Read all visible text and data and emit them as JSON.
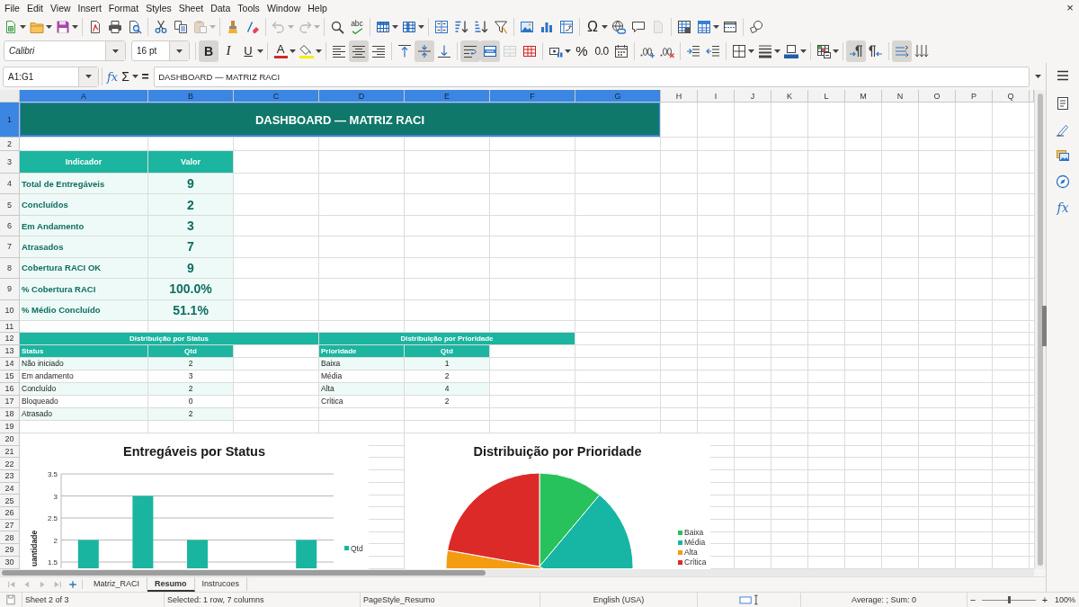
{
  "menu_bar": {
    "items": [
      "File",
      "Edit",
      "View",
      "Insert",
      "Format",
      "Styles",
      "Sheet",
      "Data",
      "Tools",
      "Window",
      "Help"
    ],
    "close": "×"
  },
  "standard_toolbar": {
    "groups": [
      [
        {
          "kind": "new",
          "disabled": false
        },
        {
          "kind": "caret",
          "disabled": false
        },
        {
          "kind": "open",
          "disabled": false
        },
        {
          "kind": "caret",
          "disabled": false
        },
        {
          "kind": "save",
          "disabled": false
        },
        {
          "kind": "caret",
          "disabled": false
        }
      ],
      [
        {
          "kind": "export-pdf",
          "disabled": false
        },
        {
          "kind": "print",
          "disabled": false
        },
        {
          "kind": "print-preview",
          "disabled": false
        }
      ],
      [
        {
          "kind": "cut",
          "disabled": false
        },
        {
          "kind": "copy",
          "disabled": false
        },
        {
          "kind": "paste",
          "disabled": true
        },
        {
          "kind": "caret",
          "disabled": true
        }
      ],
      [
        {
          "kind": "clone-formatting",
          "disabled": false
        },
        {
          "kind": "clear-formatting",
          "disabled": false
        }
      ],
      [
        {
          "kind": "undo",
          "disabled": true
        },
        {
          "kind": "caret",
          "disabled": true
        },
        {
          "kind": "redo",
          "disabled": true
        },
        {
          "kind": "caret",
          "disabled": true
        }
      ],
      [
        {
          "kind": "find-replace",
          "disabled": false
        },
        {
          "kind": "spelling",
          "label": "abc",
          "disabled": false
        }
      ],
      [
        {
          "kind": "row",
          "disabled": false
        },
        {
          "kind": "caret",
          "disabled": false
        },
        {
          "kind": "column",
          "disabled": false
        },
        {
          "kind": "caret",
          "disabled": false
        }
      ],
      [
        {
          "kind": "sort",
          "disabled": false
        },
        {
          "kind": "sort-ascending",
          "disabled": false
        },
        {
          "kind": "sort-descending",
          "disabled": false
        },
        {
          "kind": "autofilter",
          "disabled": false
        }
      ],
      [
        {
          "kind": "image",
          "disabled": false
        },
        {
          "kind": "chart",
          "disabled": false
        },
        {
          "kind": "pivot-table",
          "disabled": false
        }
      ],
      [
        {
          "kind": "special-character",
          "label": "Ω",
          "disabled": false
        },
        {
          "kind": "caret",
          "disabled": false
        },
        {
          "kind": "hyperlink",
          "disabled": false
        },
        {
          "kind": "comment",
          "disabled": false
        },
        {
          "kind": "header-footer",
          "disabled": true
        }
      ],
      [
        {
          "kind": "print-area",
          "disabled": false
        },
        {
          "kind": "freeze",
          "disabled": false
        },
        {
          "kind": "caret",
          "disabled": false
        },
        {
          "kind": "split-window",
          "disabled": false
        }
      ],
      [
        {
          "kind": "draw-functions",
          "disabled": false
        }
      ]
    ]
  },
  "formatting_toolbar": {
    "font_name": {
      "value": "Calibri"
    },
    "font_size": {
      "value": "16 pt"
    },
    "groups": [
      [
        {
          "kind": "bold",
          "label": "B",
          "active": true,
          "disabled": false
        },
        {
          "kind": "italic",
          "label": "I",
          "active": false,
          "disabled": false
        },
        {
          "kind": "underline",
          "label": "U",
          "active": false,
          "disabled": false
        },
        {
          "kind": "caret",
          "active": false,
          "disabled": false
        }
      ],
      [
        {
          "kind": "font-color",
          "label": "A",
          "active": false,
          "disabled": false
        },
        {
          "kind": "caret",
          "active": false,
          "disabled": false
        },
        {
          "kind": "highlight",
          "active": false,
          "disabled": false
        },
        {
          "kind": "caret",
          "active": false,
          "disabled": false
        }
      ],
      [
        {
          "kind": "align-left",
          "active": false,
          "disabled": false
        },
        {
          "kind": "align-center",
          "active": true,
          "disabled": false
        },
        {
          "kind": "align-right",
          "active": false,
          "disabled": false
        }
      ],
      [
        {
          "kind": "align-top",
          "active": false,
          "disabled": false
        },
        {
          "kind": "align-middle",
          "active": true,
          "disabled": false
        },
        {
          "kind": "align-bottom",
          "active": false,
          "disabled": false
        }
      ],
      [
        {
          "kind": "wrap",
          "active": true,
          "disabled": false
        },
        {
          "kind": "merge-center",
          "active": true,
          "disabled": false
        },
        {
          "kind": "merge",
          "active": false,
          "disabled": true
        },
        {
          "kind": "unmerge",
          "active": false,
          "disabled": false
        }
      ],
      [
        {
          "kind": "currency",
          "active": false,
          "disabled": false
        },
        {
          "kind": "caret",
          "active": false,
          "disabled": false
        },
        {
          "kind": "percent",
          "label": "%",
          "active": false,
          "disabled": false
        },
        {
          "kind": "number",
          "label": "0.0",
          "active": false,
          "disabled": false
        },
        {
          "kind": "date",
          "active": false,
          "disabled": false
        }
      ],
      [
        {
          "kind": "add-decimal",
          "active": false,
          "disabled": false
        },
        {
          "kind": "delete-decimal",
          "active": false,
          "disabled": false
        }
      ],
      [
        {
          "kind": "indent-increase",
          "active": false,
          "disabled": false
        },
        {
          "kind": "indent-decrease",
          "active": false,
          "disabled": false
        }
      ],
      [
        {
          "kind": "borders",
          "active": false,
          "disabled": false
        },
        {
          "kind": "caret",
          "active": false,
          "disabled": false
        },
        {
          "kind": "border-style",
          "active": false,
          "disabled": false
        },
        {
          "kind": "caret",
          "active": false,
          "disabled": false
        },
        {
          "kind": "border-color",
          "active": false,
          "disabled": false
        },
        {
          "kind": "caret",
          "active": false,
          "disabled": false
        }
      ],
      [
        {
          "kind": "conditional",
          "active": false,
          "disabled": false
        },
        {
          "kind": "caret",
          "active": false,
          "disabled": false
        }
      ],
      [
        {
          "kind": "ltr",
          "active": true,
          "disabled": false
        },
        {
          "kind": "rtl",
          "active": false,
          "disabled": false
        }
      ],
      [
        {
          "kind": "text-orientation",
          "active": true,
          "disabled": false
        },
        {
          "kind": "stacked",
          "active": false,
          "disabled": false
        }
      ]
    ]
  },
  "formula_bar": {
    "name_box": {
      "value": "A1:G1"
    },
    "buttons": [
      {
        "kind": "function-wizard",
        "label": "fx"
      },
      {
        "kind": "sum",
        "label": "Σ"
      },
      {
        "kind": "caret"
      },
      {
        "kind": "formula",
        "label": "="
      }
    ],
    "input": {
      "value": "DASHBOARD — MATRIZ RACI"
    }
  },
  "sidebar": {
    "buttons": [
      {
        "kind": "menu"
      },
      {
        "kind": "properties"
      },
      {
        "kind": "styles"
      },
      {
        "kind": "gallery"
      },
      {
        "kind": "navigator"
      },
      {
        "kind": "functions",
        "label": "fx"
      }
    ]
  },
  "sheet": {
    "columns": [
      {
        "label": "A",
        "selected": true
      },
      {
        "label": "B",
        "selected": true
      },
      {
        "label": "C",
        "selected": true
      },
      {
        "label": "D",
        "selected": true
      },
      {
        "label": "E",
        "selected": true
      },
      {
        "label": "F",
        "selected": true
      },
      {
        "label": "G",
        "selected": true
      },
      {
        "label": "H",
        "selected": false
      },
      {
        "label": "I",
        "selected": false
      },
      {
        "label": "J",
        "selected": false
      },
      {
        "label": "K",
        "selected": false
      },
      {
        "label": "L",
        "selected": false
      },
      {
        "label": "M",
        "selected": false
      },
      {
        "label": "N",
        "selected": false
      },
      {
        "label": "O",
        "selected": false
      },
      {
        "label": "P",
        "selected": false
      },
      {
        "label": "Q",
        "selected": false
      }
    ],
    "rows": [
      {
        "label": "1",
        "selected": true
      },
      {
        "label": "2",
        "selected": false
      },
      {
        "label": "3",
        "selected": false
      },
      {
        "label": "4",
        "selected": false
      },
      {
        "label": "5",
        "selected": false
      },
      {
        "label": "6",
        "selected": false
      },
      {
        "label": "7",
        "selected": false
      },
      {
        "label": "8",
        "selected": false
      },
      {
        "label": "9",
        "selected": false
      },
      {
        "label": "10",
        "selected": false
      },
      {
        "label": "11",
        "selected": false
      },
      {
        "label": "12",
        "selected": false
      },
      {
        "label": "13",
        "selected": false
      },
      {
        "label": "14",
        "selected": false
      },
      {
        "label": "15",
        "selected": false
      },
      {
        "label": "16",
        "selected": false
      },
      {
        "label": "17",
        "selected": false
      },
      {
        "label": "18",
        "selected": false
      },
      {
        "label": "19",
        "selected": false
      },
      {
        "label": "20",
        "selected": false
      },
      {
        "label": "21",
        "selected": false
      },
      {
        "label": "22",
        "selected": false
      },
      {
        "label": "23",
        "selected": false
      },
      {
        "label": "24",
        "selected": false
      },
      {
        "label": "25",
        "selected": false
      },
      {
        "label": "26",
        "selected": false
      },
      {
        "label": "27",
        "selected": false
      },
      {
        "label": "28",
        "selected": false
      },
      {
        "label": "29",
        "selected": false
      },
      {
        "label": "30",
        "selected": false
      }
    ],
    "title": "DASHBOARD — MATRIZ RACI",
    "kpi_table": {
      "headers": [
        "Indicador",
        "Valor"
      ],
      "rows": [
        [
          "Total de Entregáveis",
          "9"
        ],
        [
          "Concluídos",
          "2"
        ],
        [
          "Em Andamento",
          "3"
        ],
        [
          "Atrasados",
          "7"
        ],
        [
          "Cobertura RACI OK",
          "9"
        ],
        [
          "% Cobertura RACI",
          "100.0%"
        ],
        [
          "% Médio Concluído",
          "51.1%"
        ]
      ]
    },
    "status_table": {
      "title": "Distribuição por Status",
      "headers": [
        "Status",
        "Qtd"
      ],
      "rows": [
        [
          "Não iniciado",
          "2"
        ],
        [
          "Em andamento",
          "3"
        ],
        [
          "Concluído",
          "2"
        ],
        [
          "Bloqueado",
          "0"
        ],
        [
          "Atrasado",
          "2"
        ]
      ]
    },
    "priority_table": {
      "title": "Distribuição por Prioridade",
      "headers": [
        "Prioridade",
        "Qtd"
      ],
      "rows": [
        [
          "Baixa",
          "1"
        ],
        [
          "Média",
          "2"
        ],
        [
          "Alta",
          "4"
        ],
        [
          "Crítica",
          "2"
        ]
      ]
    },
    "charts": [
      {
        "chart_data": {
          "type": "bar",
          "title": "Entregáveis por Status",
          "ylabel": "uantidade",
          "series": [
            {
              "name": "Qtd",
              "color": "#1ab5a0",
              "values": [
                2,
                3,
                2,
                0,
                2
              ]
            }
          ],
          "ylim": [
            0,
            3.5
          ],
          "yticks": [
            1.5,
            2,
            2.5,
            3,
            3.5
          ],
          "grid": true,
          "legend": "right"
        }
      },
      {
        "chart_data": {
          "type": "pie",
          "title": "Distribuição por Prioridade",
          "categories": [
            "Baixa",
            "Média",
            "Alta",
            "Crítica"
          ],
          "values": [
            11.11,
            22.22,
            44.45,
            22.22
          ],
          "colors": [
            "#27c25c",
            "#17b5a3",
            "#f39c12",
            "#dc2a28"
          ],
          "legend": "right"
        }
      }
    ]
  },
  "sheet_tabs": {
    "nav_buttons": [
      {
        "kind": "first",
        "disabled": true
      },
      {
        "kind": "previous",
        "disabled": true
      },
      {
        "kind": "next",
        "disabled": true
      },
      {
        "kind": "last",
        "disabled": true
      },
      {
        "kind": "add",
        "disabled": false
      }
    ],
    "tabs": [
      {
        "label": "Matriz_RACI",
        "selected": false
      },
      {
        "label": "Resumo",
        "selected": true
      },
      {
        "label": "Instrucoes",
        "selected": false
      }
    ]
  },
  "status_bar": {
    "sheet_position": "Sheet 2 of 3",
    "selection": "Selected: 1 row, 7 columns",
    "page_style": "PageStyle_Resumo",
    "language": "English (USA)",
    "summary": "Average: ; Sum: 0",
    "zoom_out": "−",
    "zoom_slider": {
      "level": 0.5
    },
    "zoom_in": "+",
    "zoom": "100%"
  }
}
